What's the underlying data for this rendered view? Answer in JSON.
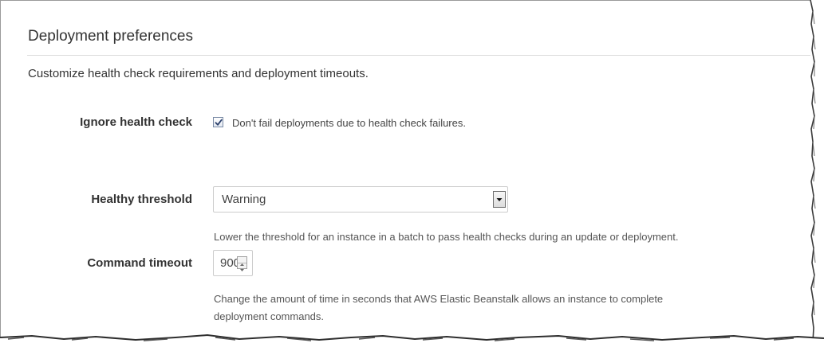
{
  "section": {
    "title": "Deployment preferences",
    "description": "Customize health check requirements and deployment timeouts."
  },
  "ignore_health_check": {
    "label": "Ignore health check",
    "checked": true,
    "checkbox_text": "Don't fail deployments due to health check failures."
  },
  "healthy_threshold": {
    "label": "Healthy threshold",
    "selected": "Warning",
    "help": "Lower the threshold for an instance in a batch to pass health checks during an update or deployment."
  },
  "command_timeout": {
    "label": "Command timeout",
    "value": "900",
    "help_line1": "Change the amount of time in seconds that AWS Elastic Beanstalk allows an instance to complete",
    "help_line2": "deployment commands."
  },
  "colors": {
    "text": "#333333",
    "rule": "#dcdcdc",
    "help_text": "#555555"
  }
}
